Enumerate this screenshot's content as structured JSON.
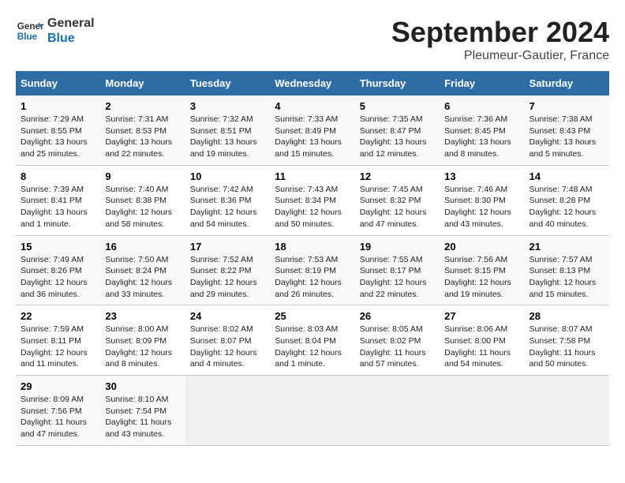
{
  "logo": {
    "line1": "General",
    "line2": "Blue"
  },
  "title": "September 2024",
  "location": "Pleumeur-Gautier, France",
  "days_header": [
    "Sunday",
    "Monday",
    "Tuesday",
    "Wednesday",
    "Thursday",
    "Friday",
    "Saturday"
  ],
  "weeks": [
    [
      {
        "day": "1",
        "sunrise": "7:29 AM",
        "sunset": "8:55 PM",
        "daylight": "13 hours and 25 minutes."
      },
      {
        "day": "2",
        "sunrise": "7:31 AM",
        "sunset": "8:53 PM",
        "daylight": "13 hours and 22 minutes."
      },
      {
        "day": "3",
        "sunrise": "7:32 AM",
        "sunset": "8:51 PM",
        "daylight": "13 hours and 19 minutes."
      },
      {
        "day": "4",
        "sunrise": "7:33 AM",
        "sunset": "8:49 PM",
        "daylight": "13 hours and 15 minutes."
      },
      {
        "day": "5",
        "sunrise": "7:35 AM",
        "sunset": "8:47 PM",
        "daylight": "13 hours and 12 minutes."
      },
      {
        "day": "6",
        "sunrise": "7:36 AM",
        "sunset": "8:45 PM",
        "daylight": "13 hours and 8 minutes."
      },
      {
        "day": "7",
        "sunrise": "7:38 AM",
        "sunset": "8:43 PM",
        "daylight": "13 hours and 5 minutes."
      }
    ],
    [
      {
        "day": "8",
        "sunrise": "7:39 AM",
        "sunset": "8:41 PM",
        "daylight": "13 hours and 1 minute."
      },
      {
        "day": "9",
        "sunrise": "7:40 AM",
        "sunset": "8:38 PM",
        "daylight": "12 hours and 58 minutes."
      },
      {
        "day": "10",
        "sunrise": "7:42 AM",
        "sunset": "8:36 PM",
        "daylight": "12 hours and 54 minutes."
      },
      {
        "day": "11",
        "sunrise": "7:43 AM",
        "sunset": "8:34 PM",
        "daylight": "12 hours and 50 minutes."
      },
      {
        "day": "12",
        "sunrise": "7:45 AM",
        "sunset": "8:32 PM",
        "daylight": "12 hours and 47 minutes."
      },
      {
        "day": "13",
        "sunrise": "7:46 AM",
        "sunset": "8:30 PM",
        "daylight": "12 hours and 43 minutes."
      },
      {
        "day": "14",
        "sunrise": "7:48 AM",
        "sunset": "8:28 PM",
        "daylight": "12 hours and 40 minutes."
      }
    ],
    [
      {
        "day": "15",
        "sunrise": "7:49 AM",
        "sunset": "8:26 PM",
        "daylight": "12 hours and 36 minutes."
      },
      {
        "day": "16",
        "sunrise": "7:50 AM",
        "sunset": "8:24 PM",
        "daylight": "12 hours and 33 minutes."
      },
      {
        "day": "17",
        "sunrise": "7:52 AM",
        "sunset": "8:22 PM",
        "daylight": "12 hours and 29 minutes."
      },
      {
        "day": "18",
        "sunrise": "7:53 AM",
        "sunset": "8:19 PM",
        "daylight": "12 hours and 26 minutes."
      },
      {
        "day": "19",
        "sunrise": "7:55 AM",
        "sunset": "8:17 PM",
        "daylight": "12 hours and 22 minutes."
      },
      {
        "day": "20",
        "sunrise": "7:56 AM",
        "sunset": "8:15 PM",
        "daylight": "12 hours and 19 minutes."
      },
      {
        "day": "21",
        "sunrise": "7:57 AM",
        "sunset": "8:13 PM",
        "daylight": "12 hours and 15 minutes."
      }
    ],
    [
      {
        "day": "22",
        "sunrise": "7:59 AM",
        "sunset": "8:11 PM",
        "daylight": "12 hours and 11 minutes."
      },
      {
        "day": "23",
        "sunrise": "8:00 AM",
        "sunset": "8:09 PM",
        "daylight": "12 hours and 8 minutes."
      },
      {
        "day": "24",
        "sunrise": "8:02 AM",
        "sunset": "8:07 PM",
        "daylight": "12 hours and 4 minutes."
      },
      {
        "day": "25",
        "sunrise": "8:03 AM",
        "sunset": "8:04 PM",
        "daylight": "12 hours and 1 minute."
      },
      {
        "day": "26",
        "sunrise": "8:05 AM",
        "sunset": "8:02 PM",
        "daylight": "11 hours and 57 minutes."
      },
      {
        "day": "27",
        "sunrise": "8:06 AM",
        "sunset": "8:00 PM",
        "daylight": "11 hours and 54 minutes."
      },
      {
        "day": "28",
        "sunrise": "8:07 AM",
        "sunset": "7:58 PM",
        "daylight": "11 hours and 50 minutes."
      }
    ],
    [
      {
        "day": "29",
        "sunrise": "8:09 AM",
        "sunset": "7:56 PM",
        "daylight": "11 hours and 47 minutes."
      },
      {
        "day": "30",
        "sunrise": "8:10 AM",
        "sunset": "7:54 PM",
        "daylight": "11 hours and 43 minutes."
      },
      null,
      null,
      null,
      null,
      null
    ]
  ]
}
